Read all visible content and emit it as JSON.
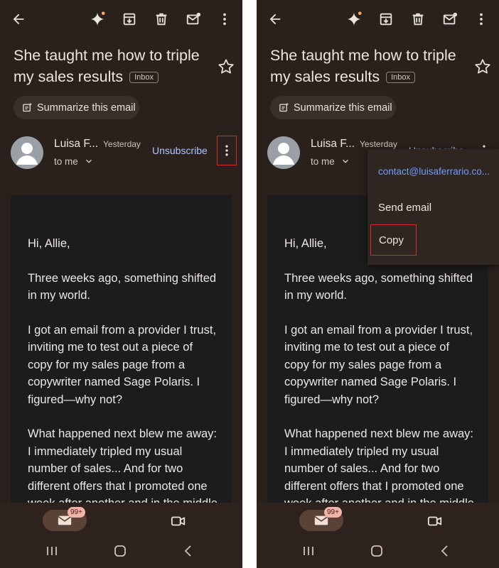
{
  "email": {
    "subject": "She taught me how to triple my sales results",
    "label_chip": "Inbox",
    "summarize_label": "Summarize this email",
    "sender_name": "Luisa F...",
    "time": "Yesterday",
    "recipient": "to me",
    "unsubscribe_label": "Unsubscribe",
    "body_paragraphs": [
      "Hi, Allie,",
      "Three weeks ago, something shifted in my world.",
      "I got an email from a provider I trust, inviting me to test out a piece of copy for my sales page from a copywriter named Sage Polaris. I figured—why not?",
      "What happened next blew me away: I immediately tripled my usual number of sales... And for two different offers that I promoted one week after another and in the middle"
    ]
  },
  "menu": {
    "email_address": "contact@luisaferrario.co...",
    "send_email_label": "Send email",
    "copy_label": "Copy"
  },
  "nav": {
    "mail_badge": "99+"
  },
  "icons": {
    "back": "arrow-back-icon",
    "gemini": "sparkle-icon",
    "archive": "archive-icon",
    "delete": "trash-icon",
    "mark_unread": "mail-unread-icon",
    "more": "more-vert-icon",
    "star": "star-icon",
    "video": "video-icon"
  },
  "colors": {
    "background": "#2a201c",
    "body_card": "#1c1c1c",
    "link": "#aec6ff",
    "menu_link": "#6e9cff",
    "highlight": "#d32b2b",
    "badge": "#f4b3a8"
  }
}
